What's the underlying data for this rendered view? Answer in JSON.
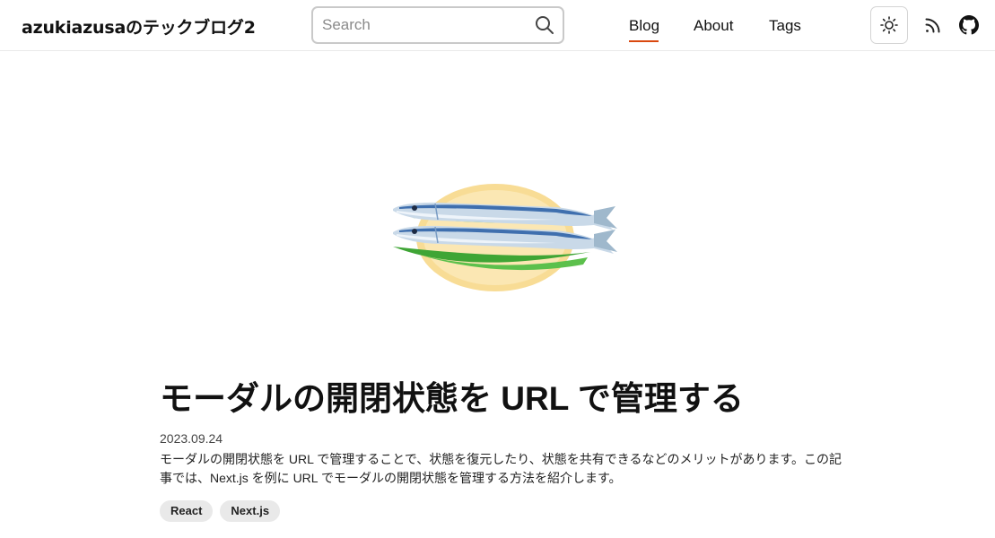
{
  "header": {
    "site_title": "azukiazusaのテックブログ2",
    "search": {
      "placeholder": "Search",
      "value": ""
    },
    "nav": [
      {
        "label": "Blog",
        "active": true
      },
      {
        "label": "About",
        "active": false
      },
      {
        "label": "Tags",
        "active": false
      }
    ],
    "icons": {
      "search": "search-icon",
      "theme": "sun-icon",
      "rss": "rss-icon",
      "github": "github-icon"
    },
    "accent_color": "#d9480f"
  },
  "article": {
    "image": "saury-fish-illustration",
    "title": "モーダルの開閉状態を URL で管理する",
    "date": "2023.09.24",
    "description": "モーダルの開閉状態を URL で管理することで、状態を復元したり、状態を共有できるなどのメリットがあります。この記事では、Next.js を例に URL でモーダルの開閉状態を管理する方法を紹介します。",
    "tags": [
      "React",
      "Next.js"
    ]
  }
}
